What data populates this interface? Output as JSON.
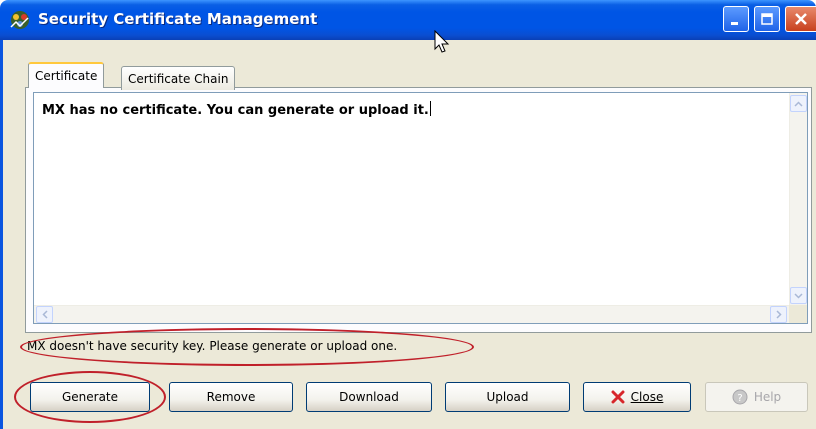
{
  "window": {
    "title": "Security Certificate Management",
    "icon": "app-certificate-icon"
  },
  "title_buttons": {
    "minimize": "minimize-icon",
    "maximize": "maximize-icon",
    "close": "close-icon"
  },
  "tabs": [
    {
      "label": "Certificate",
      "active": true
    },
    {
      "label": "Certificate Chain",
      "active": false
    }
  ],
  "certificate": {
    "text": "MX has no certificate. You can generate or upload it."
  },
  "status": {
    "message": "MX doesn't have security key. Please generate or upload one."
  },
  "buttons": {
    "generate": "Generate",
    "remove": "Remove",
    "download": "Download",
    "upload": "Upload",
    "close": "Close",
    "help": "Help"
  },
  "colors": {
    "title_bar": "#0055e5",
    "highlight": "#c0202a",
    "close_x": "#d7262b"
  }
}
